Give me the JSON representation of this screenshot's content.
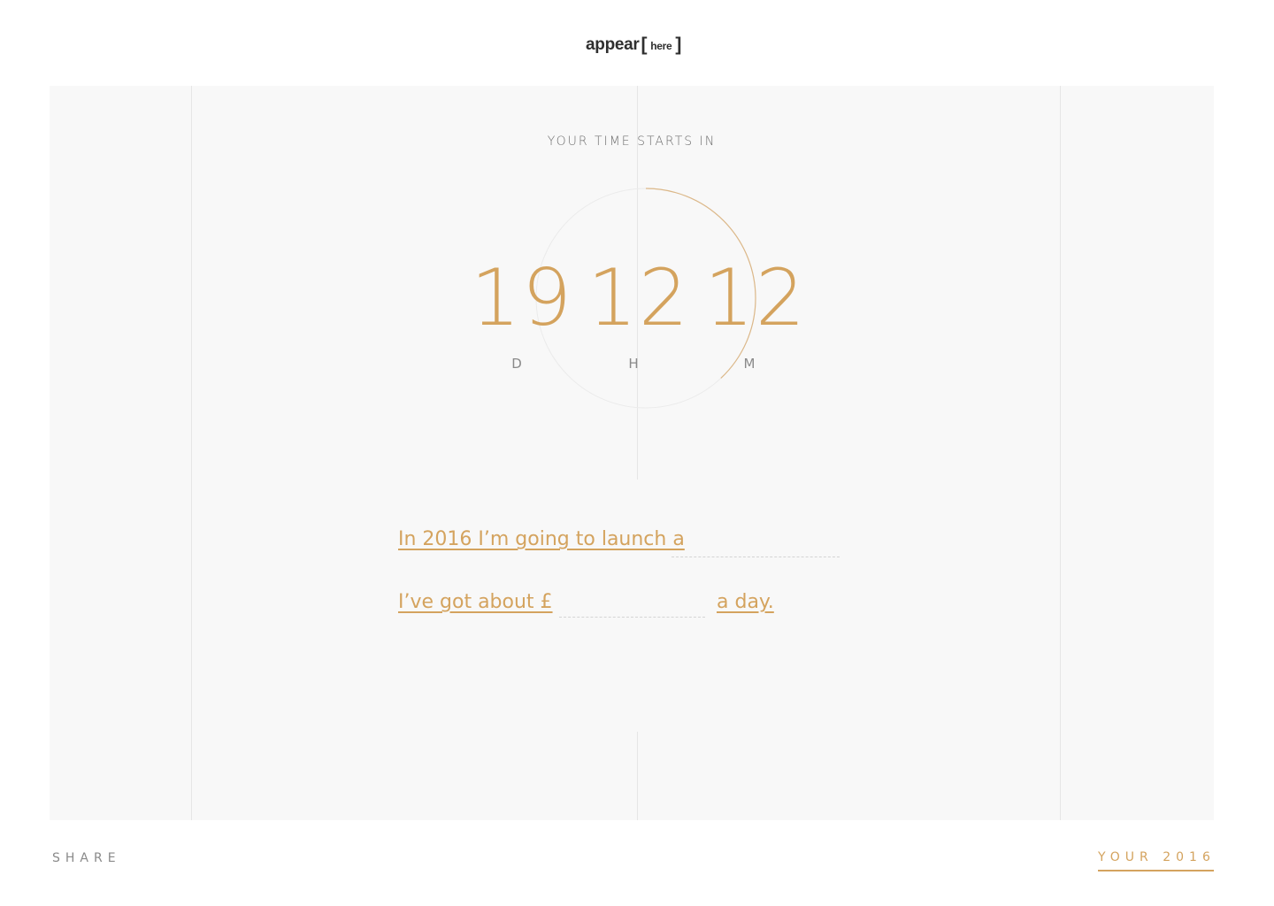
{
  "header": {
    "logo_word": "appear",
    "logo_open": "[",
    "logo_here": "here",
    "logo_close": "]"
  },
  "countdown": {
    "label": "YOUR TIME STARTS IN",
    "days": "19",
    "hours": "12",
    "minutes": "12",
    "days_unit": "D",
    "hours_unit": "H",
    "minutes_unit": "M",
    "progress": 0.38
  },
  "form": {
    "line1": "In 2016 I’m going to launch a",
    "line1_value": "",
    "line2_prefix": "I’ve got about £",
    "line2_value": "",
    "line2_suffix": "a day."
  },
  "footer": {
    "share_label": "SHARE",
    "your2016_label": "YOUR 2016"
  },
  "colors": {
    "accent": "#d4a35e",
    "panel": "#f8f8f8",
    "text_muted": "#8a8a8a"
  }
}
